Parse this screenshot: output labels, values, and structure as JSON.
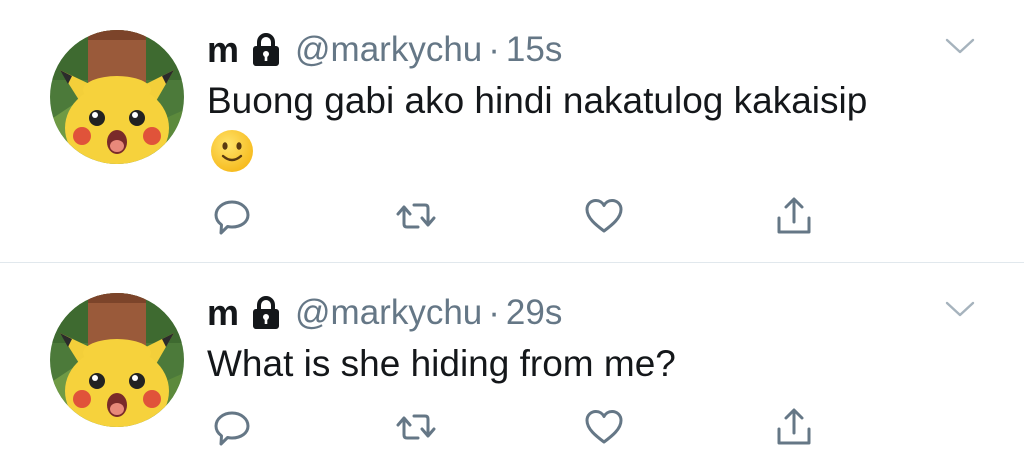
{
  "colors": {
    "name": "#14171a",
    "secondary": "#657786",
    "icon": "#657786",
    "divider": "#e1e8ed"
  },
  "tweets": [
    {
      "display_name": "m",
      "handle": "@markychu",
      "separator": "·",
      "time": "15s",
      "text": "Buong gabi ako hindi nakatulog kakaisip",
      "emoji": "slightly-smiling-face",
      "icons": [
        "lock-icon",
        "chevron-down-icon",
        "reply-icon",
        "retweet-icon",
        "like-icon",
        "share-icon"
      ]
    },
    {
      "display_name": "m",
      "handle": "@markychu",
      "separator": "·",
      "time": "29s",
      "text": "What is she hiding from me?",
      "icons": [
        "lock-icon",
        "chevron-down-icon",
        "reply-icon",
        "retweet-icon",
        "like-icon",
        "share-icon"
      ]
    }
  ]
}
